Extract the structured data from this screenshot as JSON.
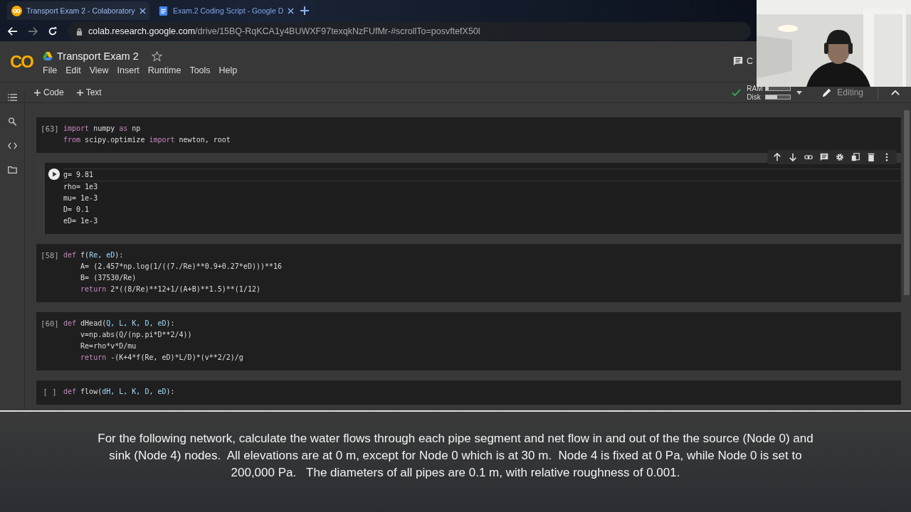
{
  "browser": {
    "tabs": [
      {
        "title": "Transport Exam 2 - Colaboratory",
        "kind": "colab",
        "selected": true
      },
      {
        "title": "Exam.2 Coding Script - Google D",
        "kind": "docs",
        "selected": false
      }
    ],
    "url_host": "colab.research.google.com",
    "url_path": "/drive/15BQ-RqKCA1y4BUWXF97texqkNzFUfMr-#scrollTo=posvftefX50l"
  },
  "notebook": {
    "logo": "CO",
    "title": "Transport Exam 2",
    "starred": false,
    "menu": [
      "File",
      "Edit",
      "View",
      "Insert",
      "Runtime",
      "Tools",
      "Help"
    ],
    "comment_label": "C",
    "add_buttons": [
      "Code",
      "Text"
    ],
    "resources": {
      "connected": true,
      "meters": [
        {
          "label": "RAM",
          "level": 0.1
        },
        {
          "label": "Disk",
          "level": 0.45
        }
      ]
    },
    "mode": "Editing"
  },
  "cells": [
    {
      "prompt": "[63]",
      "focused": false,
      "lines": [
        [
          {
            "text": "import",
            "kind": "keyword"
          },
          {
            "text": " numpy ",
            "kind": "plain"
          },
          {
            "text": "as",
            "kind": "keyword"
          },
          {
            "text": " np",
            "kind": "plain"
          }
        ],
        [
          {
            "text": "from",
            "kind": "keyword"
          },
          {
            "text": " scipy.optimize ",
            "kind": "plain"
          },
          {
            "text": "import",
            "kind": "keyword"
          },
          {
            "text": " newton, root",
            "kind": "plain"
          }
        ]
      ]
    },
    {
      "focused": true,
      "lines": [
        [
          {
            "text": "g= 9.81",
            "kind": "plain"
          }
        ],
        [
          {
            "text": "rho= 1e3",
            "kind": "plain"
          }
        ],
        [
          {
            "text": "mu= 1e-3",
            "kind": "plain"
          }
        ],
        [
          {
            "text": "D= 0.1",
            "kind": "plain"
          }
        ],
        [
          {
            "text": "eD= 1e-3",
            "kind": "plain"
          }
        ]
      ]
    },
    {
      "prompt": "[58]",
      "focused": false,
      "lines": [
        [
          {
            "text": "def",
            "kind": "keyword"
          },
          {
            "text": " f(",
            "kind": "plain"
          },
          {
            "text": "Re, eD",
            "kind": "param"
          },
          {
            "text": "):",
            "kind": "plain"
          }
        ],
        [
          {
            "text": "    A= (2.457*np.log(1/((7./Re)**0.9+0.27*eD)))**16",
            "kind": "plain"
          }
        ],
        [
          {
            "text": "    B= (37530/Re)",
            "kind": "plain"
          }
        ],
        [
          {
            "text": "    return",
            "kind": "keyword"
          },
          {
            "text": " 2*((8/Re)**12+1/(A+B)**1.5)**(1/12)",
            "kind": "plain"
          }
        ]
      ]
    },
    {
      "prompt": "[60]",
      "focused": false,
      "lines": [
        [
          {
            "text": "def",
            "kind": "keyword"
          },
          {
            "text": " dHead(",
            "kind": "plain"
          },
          {
            "text": "Q, L, K, D, eD",
            "kind": "param"
          },
          {
            "text": "):",
            "kind": "plain"
          }
        ],
        [
          {
            "text": "    v=np.abs(Q/(np.pi*D**2/4))",
            "kind": "plain"
          }
        ],
        [
          {
            "text": "    Re=rho*v*D/mu",
            "kind": "plain"
          }
        ],
        [
          {
            "text": "    return",
            "kind": "keyword"
          },
          {
            "text": " -(K+4*f(Re, eD)*L/D)*(v**2/2)/g",
            "kind": "plain"
          }
        ]
      ]
    },
    {
      "prompt": "[ ]",
      "focused": false,
      "lines": [
        [
          {
            "text": "def",
            "kind": "keyword"
          },
          {
            "text": " flow(",
            "kind": "plain"
          },
          {
            "text": "dH, L, K, D, eD",
            "kind": "param"
          },
          {
            "text": "):",
            "kind": "plain"
          }
        ]
      ]
    }
  ],
  "caption": "For the following network, calculate the water flows through each pipe segment and net flow in and out of the the source (Node 0) and sink (Node 4) nodes.  All elevations are at 0 m, except for Node 0 which is at 30 m.  Node 4 is fixed at 0 Pa, while Node 0 is set to 200,000 Pa.   The diameters of all pipes are 0.1 m, with relative roughness of 0.001."
}
